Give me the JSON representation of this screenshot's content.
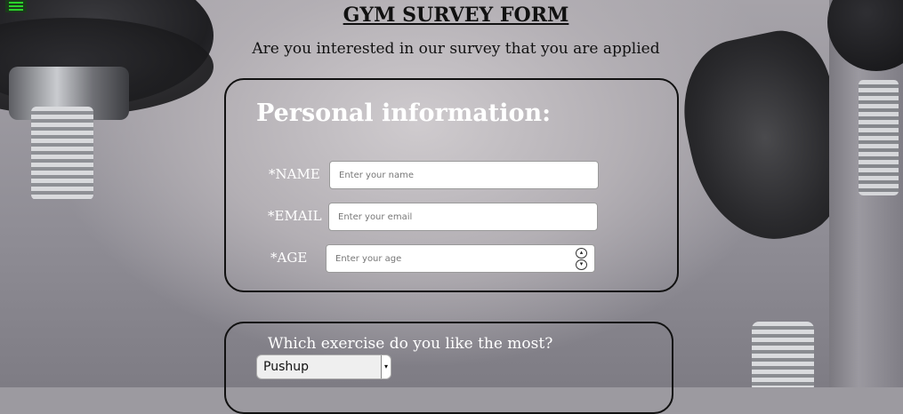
{
  "page": {
    "title": "GYM SURVEY FORM",
    "subtitle": "Are you interested in our survey that you are applied"
  },
  "menu": {
    "icon": "hamburger-menu-icon",
    "color": "#2bd12b"
  },
  "personal": {
    "heading": "Personal information:",
    "name": {
      "label": "*NAME",
      "placeholder": "Enter your name",
      "value": ""
    },
    "email": {
      "label": "*EMAIL",
      "placeholder": "Enter your email",
      "value": ""
    },
    "age": {
      "label": "*AGE",
      "placeholder": "Enter your age",
      "value": ""
    }
  },
  "exercise": {
    "question": "Which exercise do you like the most?",
    "selected": "Pushup"
  }
}
